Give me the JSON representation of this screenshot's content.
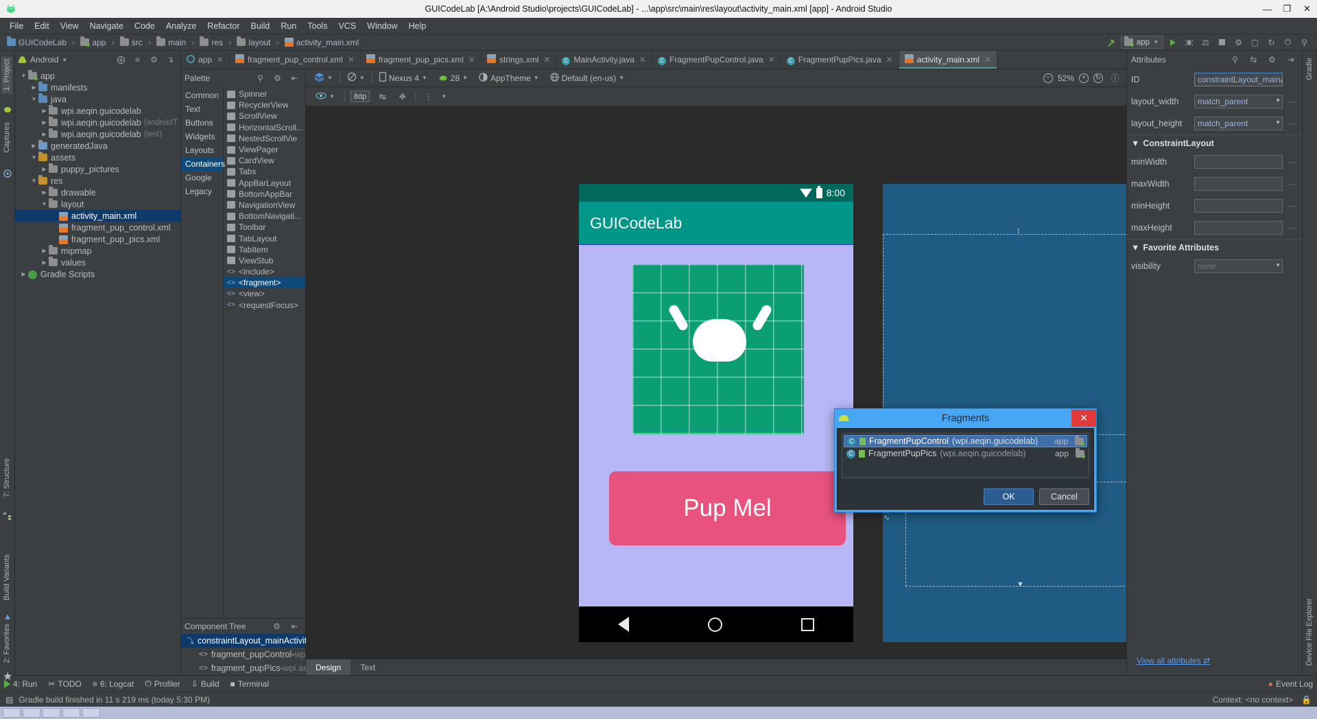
{
  "window": {
    "title": "GUICodeLab [A:\\Android Studio\\projects\\GUICodeLab] - ...\\app\\src\\main\\res\\layout\\activity_main.xml [app] - Android Studio",
    "minimize": "—",
    "maximize": "❐",
    "close": "✕"
  },
  "menu": [
    "File",
    "Edit",
    "View",
    "Navigate",
    "Code",
    "Analyze",
    "Refactor",
    "Build",
    "Run",
    "Tools",
    "VCS",
    "Window",
    "Help"
  ],
  "breadcrumb": [
    {
      "label": "GUICodeLab",
      "icon": "project-folder-icon"
    },
    {
      "label": "app",
      "icon": "module-folder-icon"
    },
    {
      "label": "src",
      "icon": "folder-icon"
    },
    {
      "label": "main",
      "icon": "folder-icon"
    },
    {
      "label": "res",
      "icon": "res-folder-icon"
    },
    {
      "label": "layout",
      "icon": "folder-icon"
    },
    {
      "label": "activity_main.xml",
      "icon": "xml-file-icon"
    }
  ],
  "toolbar": {
    "run_config": "app",
    "icons": [
      "hammer-icon",
      "run-icon",
      "debug-icon",
      "attach-debugger-icon",
      "stop-icon",
      "sdk-manager-icon",
      "avd-manager-icon",
      "sync-gradle-icon",
      "profiler-icon",
      "search-icon"
    ]
  },
  "left_strip": {
    "project_tab": "1: Project",
    "captures_tab": "Captures",
    "structure_tab": "7: Structure",
    "build_variants_tab": "Build Variants",
    "favorites_tab": "2: Favorites"
  },
  "right_strip": {
    "gradle_tab": "Gradle",
    "device_file_explorer_tab": "Device File Explorer"
  },
  "project_pane": {
    "title": "Android",
    "tree": [
      {
        "label": "app",
        "depth": 0,
        "arrow": "▼",
        "icon": "module-folder-icon",
        "selected": false
      },
      {
        "label": "manifests",
        "depth": 1,
        "arrow": "▶",
        "icon": "folder-blue-icon",
        "selected": false
      },
      {
        "label": "java",
        "depth": 1,
        "arrow": "▼",
        "icon": "folder-blue-icon",
        "selected": false
      },
      {
        "label": "wpi.aeqin.guicodelab",
        "depth": 2,
        "arrow": "▶",
        "icon": "package-icon",
        "selected": false
      },
      {
        "label": "wpi.aeqin.guicodelab",
        "dim": "(androidT",
        "depth": 2,
        "arrow": "▶",
        "icon": "package-icon",
        "selected": false
      },
      {
        "label": "wpi.aeqin.guicodelab",
        "dim": "(test)",
        "depth": 2,
        "arrow": "▶",
        "icon": "package-icon",
        "selected": false
      },
      {
        "label": "generatedJava",
        "depth": 1,
        "arrow": "▶",
        "icon": "generated-folder-icon",
        "selected": false
      },
      {
        "label": "assets",
        "depth": 1,
        "arrow": "▼",
        "icon": "res-folder-icon",
        "selected": false
      },
      {
        "label": "puppy_pictures",
        "depth": 2,
        "arrow": "▶",
        "icon": "package-icon",
        "selected": false
      },
      {
        "label": "res",
        "depth": 1,
        "arrow": "▼",
        "icon": "res-folder-icon",
        "selected": false
      },
      {
        "label": "drawable",
        "depth": 2,
        "arrow": "▶",
        "icon": "package-icon",
        "selected": false
      },
      {
        "label": "layout",
        "depth": 2,
        "arrow": "▼",
        "icon": "package-icon",
        "selected": false
      },
      {
        "label": "activity_main.xml",
        "depth": 3,
        "arrow": "",
        "icon": "xml-file-icon",
        "selected": true
      },
      {
        "label": "fragment_pup_control.xml",
        "depth": 3,
        "arrow": "",
        "icon": "xml-file-icon",
        "selected": false
      },
      {
        "label": "fragment_pup_pics.xml",
        "depth": 3,
        "arrow": "",
        "icon": "xml-file-icon",
        "selected": false
      },
      {
        "label": "mipmap",
        "depth": 2,
        "arrow": "▶",
        "icon": "package-icon",
        "selected": false
      },
      {
        "label": "values",
        "depth": 2,
        "arrow": "▶",
        "icon": "package-icon",
        "selected": false
      },
      {
        "label": "Gradle Scripts",
        "depth": 0,
        "arrow": "▶",
        "icon": "gradle-icon",
        "selected": false
      }
    ]
  },
  "editor_tabs": [
    {
      "label": "app",
      "icon": "android-run-icon",
      "active": false
    },
    {
      "label": "fragment_pup_control.xml",
      "icon": "xml-file-icon",
      "active": false
    },
    {
      "label": "fragment_pup_pics.xml",
      "icon": "xml-file-icon",
      "active": false
    },
    {
      "label": "strings.xml",
      "icon": "xml-file-icon",
      "active": false
    },
    {
      "label": "MainActivity.java",
      "icon": "java-class-icon",
      "active": false
    },
    {
      "label": "FragmentPupControl.java",
      "icon": "java-class-icon",
      "active": false
    },
    {
      "label": "FragmentPupPics.java",
      "icon": "java-class-icon",
      "active": false
    },
    {
      "label": "activity_main.xml",
      "icon": "xml-file-icon",
      "active": true
    }
  ],
  "palette": {
    "title": "Palette",
    "categories": [
      "Common",
      "Text",
      "Buttons",
      "Widgets",
      "Layouts",
      "Containers",
      "Google",
      "Legacy"
    ],
    "selected_category": "Containers",
    "items": [
      {
        "label": "Spinner",
        "icon": "spinner-icon"
      },
      {
        "label": "RecyclerView",
        "icon": "recyclerview-icon"
      },
      {
        "label": "ScrollView",
        "icon": "scrollview-icon"
      },
      {
        "label": "HorizontalScroll...",
        "icon": "horizontalscrollview-icon"
      },
      {
        "label": "NestedScrollVie",
        "icon": "nestedscrollview-icon"
      },
      {
        "label": "ViewPager",
        "icon": "viewpager-icon"
      },
      {
        "label": "CardView",
        "icon": "cardview-icon"
      },
      {
        "label": "Tabs",
        "icon": "tabs-icon"
      },
      {
        "label": "AppBarLayout",
        "icon": "appbarlayout-icon"
      },
      {
        "label": "BottomAppBar",
        "icon": "bottomappbar-icon"
      },
      {
        "label": "NavigationView",
        "icon": "navigationview-icon"
      },
      {
        "label": "BottomNavigati...",
        "icon": "bottomnavigation-icon"
      },
      {
        "label": "Toolbar",
        "icon": "toolbar-icon"
      },
      {
        "label": "TabLayout",
        "icon": "tablayout-icon"
      },
      {
        "label": "TabItem",
        "icon": "tabitem-icon"
      },
      {
        "label": "ViewStub",
        "icon": "viewstub-icon"
      },
      {
        "label": "<include>",
        "icon": "include-icon"
      },
      {
        "label": "<fragment>",
        "icon": "fragment-icon",
        "selected": true
      },
      {
        "label": "<view>",
        "icon": "view-icon"
      },
      {
        "label": "<requestFocus>",
        "icon": "requestfocus-icon"
      }
    ]
  },
  "component_tree": {
    "title": "Component Tree",
    "nodes": [
      {
        "label": "constraintLayout_mainActivity",
        "dim": "",
        "depth": 0,
        "icon": "constraintlayout-icon",
        "selected": true
      },
      {
        "label": "fragment_pupControl-",
        "dim": " wpi.a...",
        "depth": 1,
        "icon": "fragment-tag-icon",
        "selected": false
      },
      {
        "label": "fragment_pupPics-",
        "dim": " wpi.aeqi...",
        "depth": 1,
        "icon": "fragment-tag-icon",
        "selected": false
      }
    ]
  },
  "design_toolbar": {
    "view_mode_icon": "layers-icon",
    "orientation_icon": "rotate-icon",
    "device": "Nexus 4",
    "api_level": "28",
    "theme": "AppTheme",
    "locale": "Default (en-us)",
    "zoom": "52%",
    "zoom_out_icon": "zoom-out-icon",
    "zoom_in_icon": "zoom-in-icon",
    "refresh_icon": "refresh-icon",
    "warnings_icon": "warnings-icon"
  },
  "design_toolbar2": {
    "eye_icon": "visibility-icon",
    "margin_value": "8dp",
    "pack_icon": "pack-icon",
    "align_icon": "align-icon",
    "guideline_icon": "guideline-icon",
    "baseline_icon": "baseline-icon"
  },
  "preview": {
    "status_time": "8:00",
    "app_title": "GUICodeLab",
    "button_label": "Pup Mel",
    "nav_back_icon": "nav-back-icon",
    "nav_home_icon": "nav-home-icon",
    "nav_recents_icon": "nav-recents-icon",
    "wifi_icon": "wifi-icon",
    "battery_icon": "battery-icon"
  },
  "dialog": {
    "title": "Fragments",
    "close_label": "✕",
    "items": [
      {
        "name": "FragmentPupControl",
        "package": "(wpi.aeqin.guicodelab)",
        "module": "app",
        "selected": true
      },
      {
        "name": "FragmentPupPics",
        "package": "(wpi.aeqin.guicodelab)",
        "module": "app",
        "selected": false
      }
    ],
    "ok_label": "OK",
    "cancel_label": "Cancel"
  },
  "design_text_tabs": [
    {
      "label": "Design",
      "active": true
    },
    {
      "label": "Text",
      "active": false
    }
  ],
  "attributes": {
    "title": "Attributes",
    "rows": [
      {
        "label": "ID",
        "value": "constraintLayout_mainA",
        "type": "text",
        "focus": true,
        "dots": false
      },
      {
        "label": "layout_width",
        "value": "match_parent",
        "type": "combo",
        "dots": true
      },
      {
        "label": "layout_height",
        "value": "match_parent",
        "type": "combo",
        "dots": true
      }
    ],
    "section1": "ConstraintLayout",
    "section1_rows": [
      {
        "label": "minWidth",
        "value": "",
        "type": "text",
        "dots": true
      },
      {
        "label": "maxWidth",
        "value": "",
        "type": "text",
        "dots": true
      },
      {
        "label": "minHeight",
        "value": "",
        "type": "text",
        "dots": true
      },
      {
        "label": "maxHeight",
        "value": "",
        "type": "text",
        "dots": true
      }
    ],
    "section2": "Favorite Attributes",
    "section2_rows": [
      {
        "label": "visibility",
        "value": "none",
        "type": "combo",
        "dots": false,
        "placeholder": true
      }
    ],
    "view_all": "View all attributes",
    "search_icon": "search-icon",
    "sort_icon": "sort-icon",
    "settings_icon": "gear-icon",
    "collapse_icon": "collapse-icon"
  },
  "bottom_bar": {
    "items": [
      {
        "label": "4: Run",
        "icon": "run-icon"
      },
      {
        "label": "TODO",
        "icon": "todo-icon"
      },
      {
        "label": "6: Logcat",
        "icon": "logcat-icon"
      },
      {
        "label": "Profiler",
        "icon": "profiler-icon"
      },
      {
        "label": "Build",
        "icon": "build-icon"
      },
      {
        "label": "Terminal",
        "icon": "terminal-icon"
      }
    ],
    "event_log": "Event Log",
    "event_log_icon": "event-log-icon"
  },
  "status_bar": {
    "message": "Gradle build finished in 11 s 219 ms (today 5:30 PM)",
    "context": "Context: <no context>",
    "lock_icon": "lock-icon",
    "message_icon": "message-icon"
  }
}
